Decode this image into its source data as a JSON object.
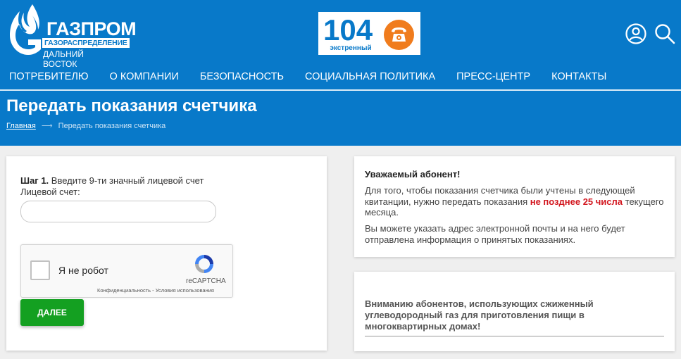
{
  "header": {
    "logo": {
      "brand": "ГАЗПРОМ",
      "sub1": "ГАЗОРАСПРЕДЕЛЕНИЕ",
      "sub2": "ДАЛЬНИЙ ВОСТОК"
    },
    "emergency": {
      "number": "104",
      "label": "экстренный",
      "icon": "phone-icon"
    },
    "icons": [
      "user-icon",
      "search-icon"
    ],
    "colors": {
      "header_bg": "#0879c9",
      "accent_orange": "#f07c1d",
      "button_green": "#14a021",
      "highlight_red": "#d2161e"
    }
  },
  "nav": {
    "items": [
      {
        "label": "ПОТРЕБИТЕЛЮ"
      },
      {
        "label": "О КОМПАНИИ"
      },
      {
        "label": "БЕЗОПАСНОСТЬ"
      },
      {
        "label": "СОЦИАЛЬНАЯ ПОЛИТИКА"
      },
      {
        "label": "ПРЕСС-ЦЕНТР"
      },
      {
        "label": "КОНТАКТЫ"
      }
    ]
  },
  "page": {
    "title": "Передать показания счетчика",
    "breadcrumb": {
      "home": "Главная",
      "current": "Передать показания счетчика"
    }
  },
  "form": {
    "step_label": "Шаг 1.",
    "step_text": "Введите 9-ти значный лицевой счет",
    "account_label": "Лицевой счет:",
    "account_value": "",
    "captcha": {
      "text": "Я не робот",
      "brand": "reCAPTCHA",
      "privacy": "Конфиденциальность",
      "separator": " - ",
      "terms": "Условия использования"
    },
    "next_button": "ДАЛЕЕ"
  },
  "info": {
    "title": "Уважаемый абонент!",
    "p1_before": "Для того, чтобы показания счетчика были учтены в следующей квитанции, нужно передать показания ",
    "p1_highlight": "не позднее 25 числа",
    "p1_after": " текущего месяца.",
    "p2": "Вы можете указать адрес электронной почты и на него будет отправлена информация о принятых показаниях."
  },
  "notice": {
    "text": "Вниманию абонентов, использующих сжиженный углеводородный газ для приготовления пищи в многоквартирных домах!"
  }
}
